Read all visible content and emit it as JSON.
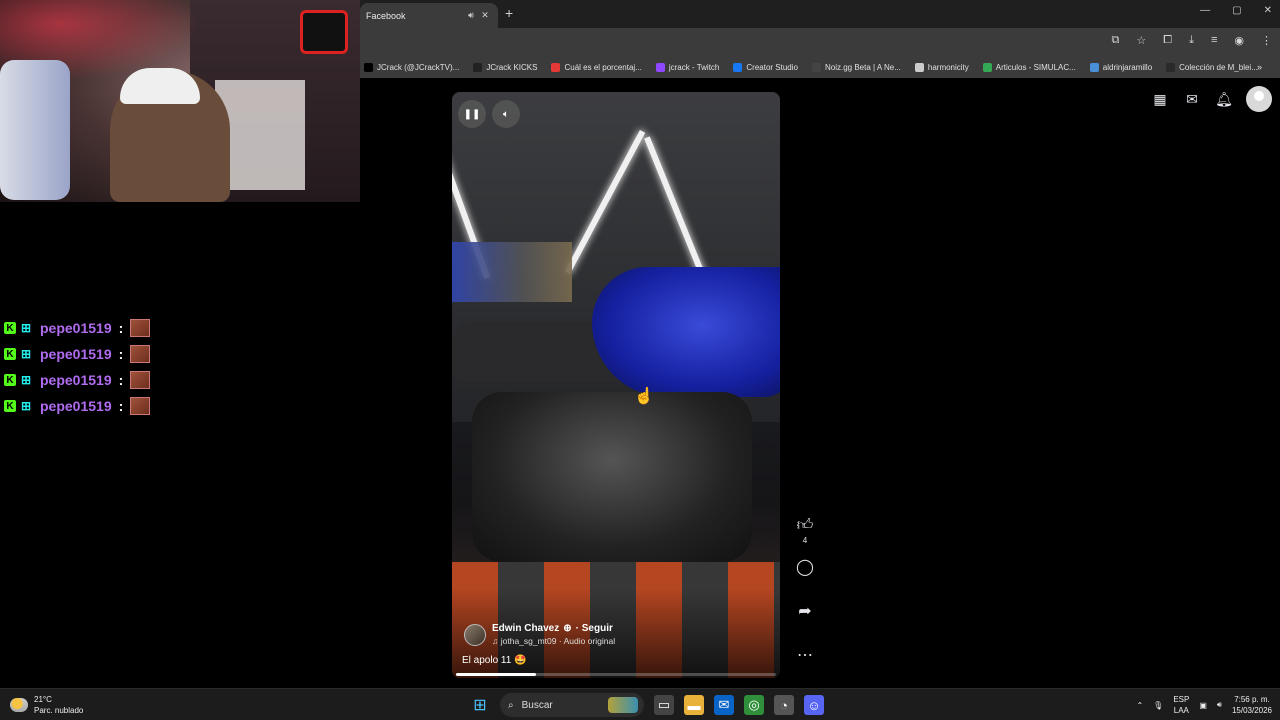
{
  "browser": {
    "tab_title": "Facebook",
    "tab_icons": {
      "audio": "speaker-icon",
      "close": "close-icon"
    },
    "new_tab": "+",
    "window_controls": [
      "—",
      "▢",
      "✕"
    ],
    "bookmarks": [
      {
        "label": "JCrack (@JCrackTV)...",
        "color": "#000000"
      },
      {
        "label": "JCrack KICKS",
        "color": "#222222"
      },
      {
        "label": "Cuál es el porcentaj...",
        "color": "#e53935"
      },
      {
        "label": "jcrack - Twitch",
        "color": "#9146ff"
      },
      {
        "label": "Creator Studio",
        "color": "#1877f2"
      },
      {
        "label": "Noiz.gg Beta | A Ne...",
        "color": "#444444"
      },
      {
        "label": "harmonicity",
        "color": "#cccccc"
      },
      {
        "label": "Articulos - SIMULAC...",
        "color": "#34a853"
      },
      {
        "label": "aldrinjaramillo",
        "color": "#4a90d9"
      },
      {
        "label": "Colección de M_blei...",
        "color": "#2a2a2a"
      }
    ],
    "bookmarks_more": "»"
  },
  "chat": {
    "messages": [
      {
        "badge_k": "K",
        "badge_s": "⊞",
        "username": "pepe01519",
        "colon": ":"
      },
      {
        "badge_k": "K",
        "badge_s": "⊞",
        "username": "pepe01519",
        "colon": ":"
      },
      {
        "badge_k": "K",
        "badge_s": "⊞",
        "username": "pepe01519",
        "colon": ":"
      },
      {
        "badge_k": "K",
        "badge_s": "⊞",
        "username": "pepe01519",
        "colon": ":"
      }
    ]
  },
  "reel": {
    "author_name": "Edwin Chavez",
    "follow_label": "· Seguir",
    "audio": "♫ jotha_sg_mt09 · Audio original",
    "caption": "El apolo 11 🤩",
    "like_count": "4",
    "progress": 0.25
  },
  "taskbar": {
    "weather_temp": "21°C",
    "weather_desc": "Parc. nublado",
    "search_label": "Buscar",
    "lang_top": "ESP",
    "lang_bottom": "LAA",
    "time": "7:56 p. m.",
    "date": "15/03/2026"
  }
}
